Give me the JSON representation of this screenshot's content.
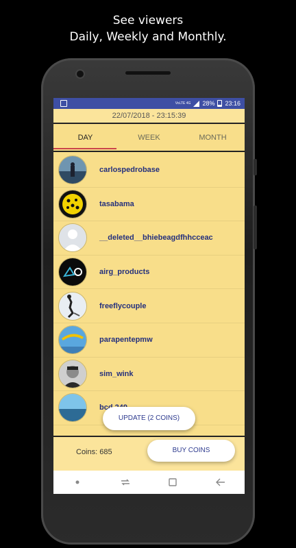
{
  "promo": {
    "line1": "See viewers",
    "line2": "Daily, Weekly and Monthly."
  },
  "status": {
    "network": "VoLTE 4G",
    "battery": "28%",
    "time": "23:16"
  },
  "header": {
    "datetime": "22/07/2018 - 23:15:39"
  },
  "tabs": [
    {
      "label": "DAY"
    },
    {
      "label": "WEEK"
    },
    {
      "label": "MONTH"
    }
  ],
  "viewers": [
    {
      "name": "carlospedrobase"
    },
    {
      "name": "tasabama"
    },
    {
      "name": "__deleted__bhiebeagdfhhcceac"
    },
    {
      "name": "airg_products"
    },
    {
      "name": "freeflycouple"
    },
    {
      "name": "parapentepmw"
    },
    {
      "name": "sim_wink"
    },
    {
      "name": "bcd 249"
    }
  ],
  "actions": {
    "update_label": "UPDATE (2 COINS)",
    "buy_label": "BUY COINS",
    "coins_text": "Coins: 685"
  },
  "colors": {
    "accent": "#3e4fa4",
    "background": "#f8de8a",
    "tab_indicator": "#c9444a",
    "username": "#24307d"
  }
}
